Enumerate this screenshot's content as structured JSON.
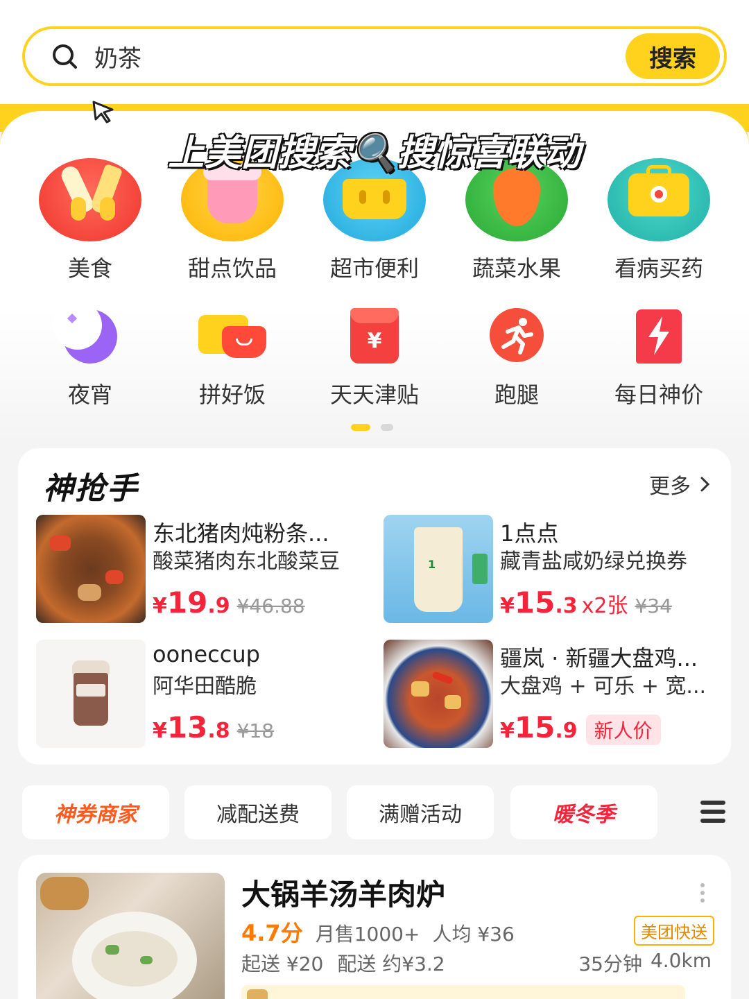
{
  "search": {
    "value": "奶茶",
    "button_label": "搜索"
  },
  "banner": {
    "text": "上美团搜索🔍搜惊喜联动"
  },
  "categories": {
    "row1": [
      {
        "label": "美食",
        "icon": "tableware-icon",
        "color": "#f5463c"
      },
      {
        "label": "甜点饮品",
        "icon": "dessert-cup-icon",
        "color": "#ffc21a"
      },
      {
        "label": "超市便利",
        "icon": "shopping-basket-icon",
        "color": "#35c0e8"
      },
      {
        "label": "蔬菜水果",
        "icon": "carrot-icon",
        "color": "#3fbf4a"
      },
      {
        "label": "看病买药",
        "icon": "medicine-box-icon",
        "color": "#2fc2b7"
      }
    ],
    "row2": [
      {
        "label": "夜宵",
        "icon": "moon-icon",
        "color": "#9b64f5"
      },
      {
        "label": "拼好饭",
        "icon": "bowl-icon",
        "color": "#ff5a3a"
      },
      {
        "label": "天天津贴",
        "icon": "red-packet-icon",
        "color": "#f54040"
      },
      {
        "label": "跑腿",
        "icon": "runner-icon",
        "color": "#f54e3a"
      },
      {
        "label": "每日神价",
        "icon": "lightning-tag-icon",
        "color": "#f53a4a"
      }
    ],
    "page_indicator": {
      "current": 1,
      "total": 2
    }
  },
  "deals": {
    "title": "神抢手",
    "more_label": "更多",
    "items": [
      {
        "name": "东北猪肉炖粉条...",
        "sub": "酸菜猪肉东北酸菜豆",
        "currency": "¥",
        "price_int": "19",
        "price_dec": ".9",
        "qty": "",
        "old_price": "¥46.88",
        "tag": ""
      },
      {
        "name": "1点点",
        "sub": "藏青盐咸奶绿兑换券",
        "currency": "¥",
        "price_int": "15",
        "price_dec": ".3",
        "qty": "x2张",
        "old_price": "¥34",
        "tag": ""
      },
      {
        "name": "ooneccup",
        "sub": "阿华田酷脆",
        "currency": "¥",
        "price_int": "13",
        "price_dec": ".8",
        "qty": "",
        "old_price": "¥18",
        "tag": ""
      },
      {
        "name": "疆岚 · 新疆大盘鸡...",
        "sub": "大盘鸡 + 可乐 + 宽...",
        "currency": "¥",
        "price_int": "15",
        "price_dec": ".9",
        "qty": "",
        "old_price": "",
        "tag": "新人价"
      }
    ]
  },
  "filters": [
    "神券商家",
    "减配送费",
    "满赠活动",
    "暖冬季"
  ],
  "store": {
    "name": "大锅羊汤羊肉炉",
    "rating": "4.7分",
    "monthly_sales": "月售1000+",
    "avg_price": "人均 ¥36",
    "badge": "美团快送",
    "min_order": "起送 ¥20",
    "delivery_fee": "配送 约¥3.2",
    "delivery_time": "35分钟",
    "distance": "4.0km"
  },
  "colors": {
    "brand_yellow": "#ffd21e",
    "price_red": "#f5243b",
    "rating_orange": "#ff7a00"
  }
}
